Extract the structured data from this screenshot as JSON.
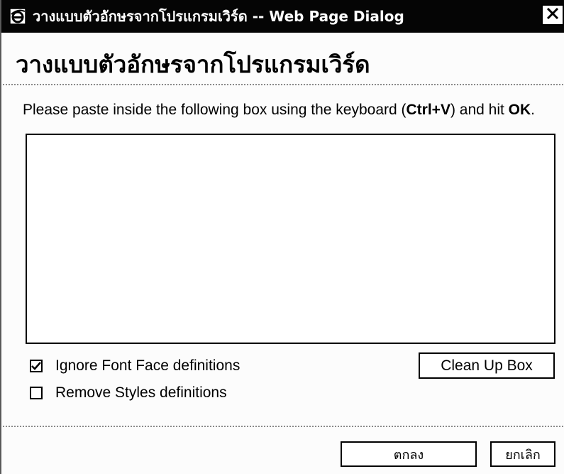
{
  "window": {
    "title": "วางแบบตัวอักษรจากโปรแกรมเวิร์ด -- Web Page Dialog",
    "app_icon": "internet-explorer-icon",
    "close_icon": "close-icon"
  },
  "dialog": {
    "heading": "วางแบบตัวอักษรจากโปรแกรมเวิร์ด",
    "instructions_prefix": "Please paste inside the following box using the keyboard (",
    "instructions_shortcut": "Ctrl+V",
    "instructions_middle": ") and hit ",
    "instructions_ok": "OK",
    "instructions_suffix": ".",
    "paste_box_value": ""
  },
  "options": [
    {
      "label": "Ignore Font Face definitions",
      "checked": true
    },
    {
      "label": "Remove Styles definitions",
      "checked": false
    }
  ],
  "buttons": {
    "cleanup": "Clean Up Box",
    "ok": "ตกลง",
    "cancel": "ยกเลิก"
  }
}
